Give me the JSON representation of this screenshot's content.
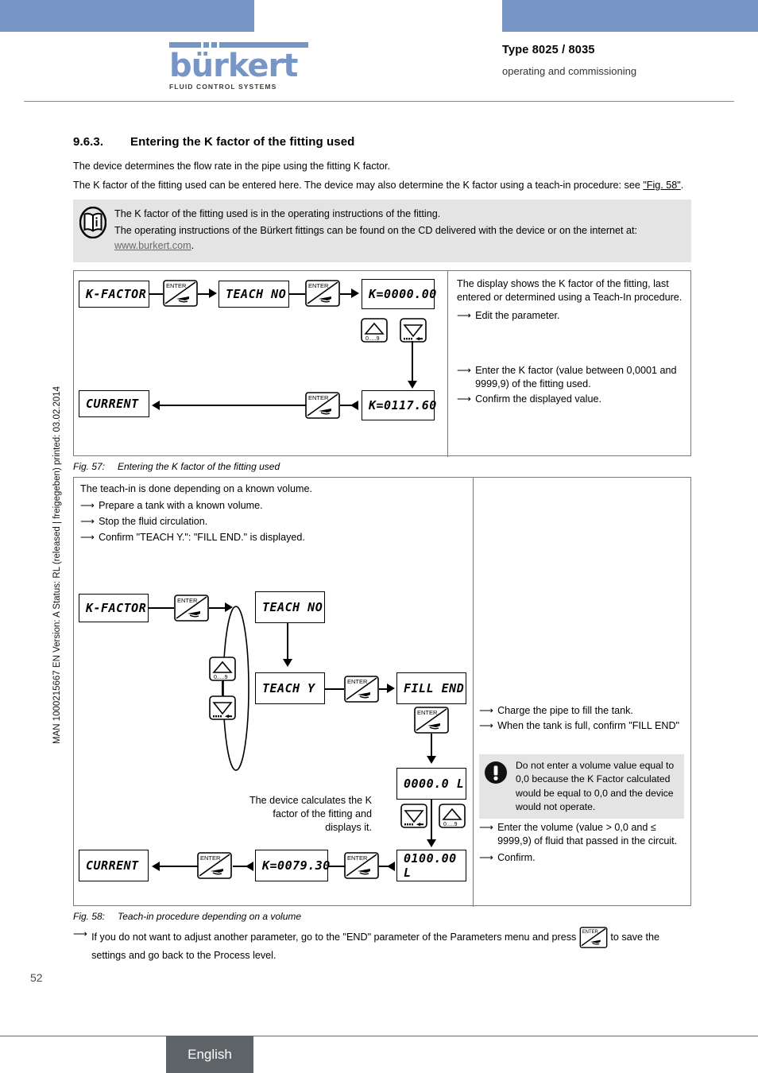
{
  "header": {
    "type_title": "Type 8025 / 8035",
    "subtitle": "operating and commissioning",
    "logo_word": "bürkert",
    "logo_tagline": "FLUID CONTROL SYSTEMS"
  },
  "sidebar": {
    "doc_meta": "MAN 1000215667  EN  Version: A  Status: RL (released | freigegeben)  printed: 03.02.2014"
  },
  "section": {
    "number": "9.6.3.",
    "title": "Entering the K factor of the fitting used",
    "para1": "The device determines the flow rate in the pipe using the fitting K factor.",
    "para2_a": "The K factor of the fitting used can be entered here. The device may also determine the K factor using a teach-in procedure: see ",
    "para2_link": "\"Fig. 58\"",
    "para2_b": "."
  },
  "note_box": {
    "icon": "book-info-icon",
    "line1": "The K factor of the fitting used is in the operating instructions of the fitting.",
    "line2_a": "The operating instructions of the Bürkert fittings can be found on the CD delivered with the device or on the internet at: ",
    "line2_link": "www.burkert.com",
    "line2_b": "."
  },
  "fig57": {
    "caption_num": "Fig. 57:",
    "caption_text": "Entering the K factor of the fitting used",
    "boxes": {
      "k_factor": "K-FACTOR",
      "teach_no": "TEACH NO",
      "k_zero": "K=0000.00",
      "k_value": "K=0117.60",
      "current": "CURRENT"
    },
    "keys": {
      "enter": "ENTER",
      "up_label": "0.....9",
      "down_label": "....<"
    },
    "explain": {
      "p1": "The display shows the K factor of the fitting, last entered or determined using a Teach-In procedure.",
      "l1": "Edit the parameter.",
      "l2": "Enter the K factor (value between 0,0001 and 9999,9) of the fitting used.",
      "l3": "Confirm the displayed value."
    }
  },
  "fig58": {
    "caption_num": "Fig. 58:",
    "caption_text": "Teach-in procedure depending on a volume",
    "intro": {
      "p1": "The teach-in is done depending on a known volume.",
      "l1": "Prepare a tank with a known volume.",
      "l2": "Stop the fluid circulation.",
      "l3": "Confirm \"TEACH Y.\": \"FILL END.\" is displayed."
    },
    "boxes": {
      "k_factor": "K-FACTOR",
      "teach_no": "TEACH NO",
      "teach_y": "TEACH Y",
      "fill_end": "FILL END",
      "volume_zero": "0000.0   L",
      "volume_set": "0100.00   L",
      "k_result": "K=0079.30",
      "current": "CURRENT"
    },
    "keys": {
      "enter": "ENTER",
      "up_label": "0.....9",
      "down_label": "....<"
    },
    "explain": {
      "l1": "Charge the pipe to fill the tank.",
      "l2": "When the tank is full, confirm \"FILL END\"",
      "warning_icon": "exclamation-warning-icon",
      "warning": "Do not enter a volume value equal to 0,0 because the K Factor calculated would be equal to 0,0 and the device would not operate.",
      "l3": "Enter the volume (value > 0,0  and ≤ 9999,9) of fluid that passed in the circuit.",
      "l4": "Confirm."
    },
    "center_note": "The device calculates the K factor of the fitting and displays it."
  },
  "closing": {
    "text_a": "If you do not want to adjust another parameter, go to the \"END\" parameter of the Parameters menu and press ",
    "text_b": " to save the settings and go back to the Process level."
  },
  "footer": {
    "page_number": "52",
    "language": "English"
  },
  "colors": {
    "banner_blue": "#7796c6",
    "note_grey": "#e4e4e4",
    "footer_grey": "#5e6368"
  }
}
